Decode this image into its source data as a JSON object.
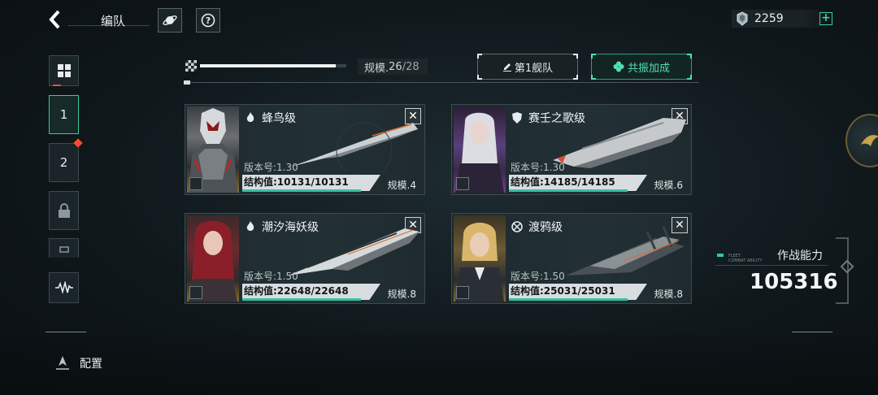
{
  "header": {
    "back_label": "‹",
    "title": "编队",
    "planet_icon": "planet-icon",
    "help_icon": "help-icon",
    "currency": {
      "icon": "crystal-icon",
      "value": "2259",
      "add_label": "+"
    }
  },
  "sidebar": {
    "items": [
      {
        "icon": "grid-icon",
        "label": ""
      },
      {
        "label": "1",
        "active": true
      },
      {
        "label": "2",
        "notify": true
      },
      {
        "icon": "lock-icon",
        "label": ""
      },
      {
        "icon": "square-icon",
        "label": ""
      },
      {
        "icon": "waveform-icon",
        "label": ""
      }
    ]
  },
  "fleet_scale": {
    "label": "规模.",
    "current": "26",
    "max": "/28",
    "fill_fraction": 0.93
  },
  "fleet_button": {
    "icon": "pencil-icon",
    "label": "第1舰队"
  },
  "resonance_button": {
    "icon": "clover-icon",
    "label": "共振加成"
  },
  "ships": [
    {
      "class": "蜂鸟级",
      "class_icon": "flame-icon",
      "version": "版本号:1.30",
      "structure": "结构值:10131/10131",
      "scale": "规模.4",
      "structure_fraction": 1.0,
      "accent": "#b88a2a"
    },
    {
      "class": "赛壬之歌级",
      "class_icon": "shield-icon",
      "version": "版本号:1.30",
      "structure": "结构值:14185/14185",
      "scale": "规模.6",
      "structure_fraction": 1.0,
      "accent": "#7a3a9a"
    },
    {
      "class": "潮汐海妖级",
      "class_icon": "flame-icon",
      "version": "版本号:1.50",
      "structure": "结构值:22648/22648",
      "scale": "规模.8",
      "structure_fraction": 1.0,
      "accent": "#b88a2a"
    },
    {
      "class": "渡鸦级",
      "class_icon": "target-icon",
      "version": "版本号:1.50",
      "structure": "结构值:25031/25031",
      "scale": "规模.8",
      "structure_fraction": 1.0,
      "accent": "#b88a2a"
    }
  ],
  "combat_power": {
    "label": "作战能力",
    "sub_label": "FLEET\nCOMBAT ABILITY",
    "value": "105316"
  },
  "footer": {
    "config_label": "配置",
    "config_icon": "ship-config-icon"
  },
  "colors": {
    "accent_green": "#38c9a0",
    "notify_red": "#ff4b2e",
    "panel_bg": "#1b2428"
  }
}
